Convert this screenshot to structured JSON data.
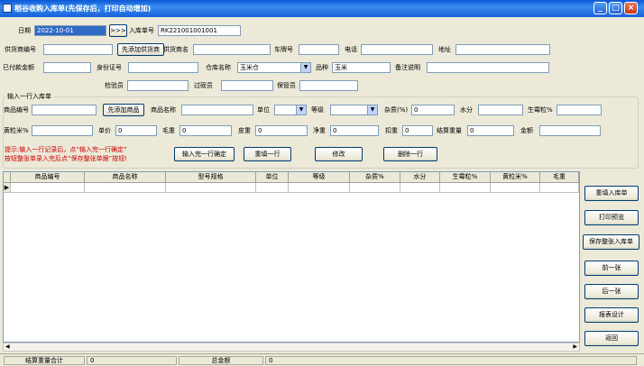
{
  "window": {
    "title": "稻谷收购入库单(先保存后，打印自动增加)",
    "buttons": {
      "minimize": "_",
      "maximize": "□",
      "close": "×"
    }
  },
  "header": {
    "date_label": "日期",
    "date_value": "2022-10-01",
    "arrow_label": ">>>",
    "entry_no_label": "入库单号",
    "entry_no_value": "RK221001001001"
  },
  "supplier": {
    "code_label": "供货商编号",
    "add_button": "先添加供货商",
    "name_label": "供货商名",
    "plate_label": "车牌号",
    "phone_label": "电话",
    "address_label": "地址"
  },
  "payment": {
    "paid_label": "已付款金额",
    "id_label": "身份证号",
    "warehouse_label": "仓库名称",
    "warehouse_value": "玉米仓",
    "variety_label": "品种",
    "variety_value": "玉米",
    "remark_label": "备注说明"
  },
  "staff": {
    "inspector_label": "检验员",
    "weigher_label": "过磅员",
    "keeper_label": "保管员"
  },
  "entry_group": {
    "title": "输入一行入库单",
    "product_code_label": "商品编号",
    "add_product_button": "先添加商品",
    "product_name_label": "商品名称",
    "unit_label": "单位",
    "grade_label": "等级",
    "impurity_label": "杂质(%)",
    "impurity_value": "0",
    "moisture_label": "水分",
    "mildew_label": "生霉粒%",
    "yellow_label": "黄粒米%",
    "price_label": "单价",
    "price_value": "0",
    "gross_label": "毛重",
    "gross_value": "0",
    "tare_label": "皮重",
    "tare_value": "0",
    "net_label": "净重",
    "net_value": "0",
    "deduct_label": "扣重",
    "deduct_value": "0",
    "settle_label": "结算重量",
    "settle_value": "0",
    "amount_label": "金额",
    "hint_line1": "提示:输入一行记录后，点“输入完一行确定”",
    "hint_line2": "按钮整张单录入完后点“保存整张单据”按钮!",
    "confirm_button": "输入完一行确定",
    "reset_button": "重填一行",
    "modify_button": "修改",
    "delete_button": "删除一行"
  },
  "grid": {
    "columns": [
      "商品编号",
      "商品名称",
      "型号规格",
      "单位",
      "等级",
      "杂质%",
      "水分",
      "生霉粒%",
      "黄粒米%",
      "毛重"
    ],
    "row_marker": "▶"
  },
  "side_buttons": {
    "refill": "重填入库单",
    "print_preview": "打印预览",
    "save_all": "保存整张入库单",
    "prev": "前一张",
    "next": "后一张",
    "report_design": "报表设计",
    "back": "返回"
  },
  "status_bar": {
    "settle_total_label": "结算重量合计",
    "settle_total_value": "0",
    "total_amount_label": "总金额",
    "total_amount_value": "0"
  }
}
